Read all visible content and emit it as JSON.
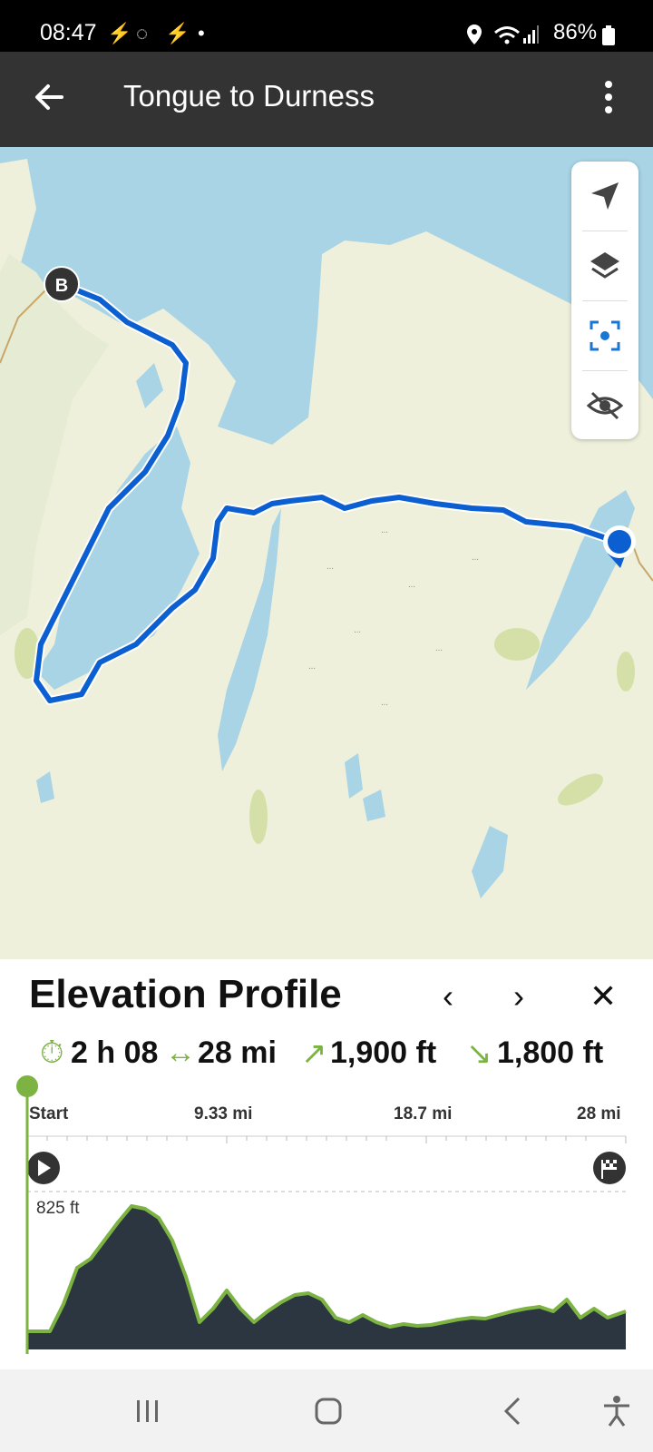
{
  "status_bar": {
    "time": "08:47",
    "battery": "86%",
    "icons": [
      "activity-icon",
      "whatsapp-icon",
      "activity-icon",
      "dot-icon",
      "location-icon",
      "wifi-icon",
      "signal-icon",
      "battery-icon"
    ]
  },
  "app_bar": {
    "title": "Tongue to Durness",
    "back_icon": "arrow-left-icon",
    "menu_icon": "more-vert-icon"
  },
  "map": {
    "end_marker_label": "B",
    "route_color": "#0b5fd1",
    "controls": [
      "navigate-icon",
      "layers-icon",
      "focus-icon",
      "visibility-off-icon"
    ]
  },
  "elevation_panel": {
    "title": "Elevation Profile",
    "prev": "‹",
    "next": "›",
    "close": "✕",
    "stats": {
      "duration": "2 h 08",
      "distance": "28 mi",
      "ascent": "1,900 ft",
      "descent": "1,800 ft"
    },
    "axis_labels": [
      "Start",
      "9.33 mi",
      "18.7 mi",
      "28 mi"
    ],
    "max_label": "825 ft",
    "accent_color": "#7cb342",
    "fill_color": "#2b3640"
  },
  "nav_bar": {
    "icons": [
      "recent-apps-icon",
      "home-icon",
      "back-icon",
      "accessibility-icon"
    ]
  }
}
